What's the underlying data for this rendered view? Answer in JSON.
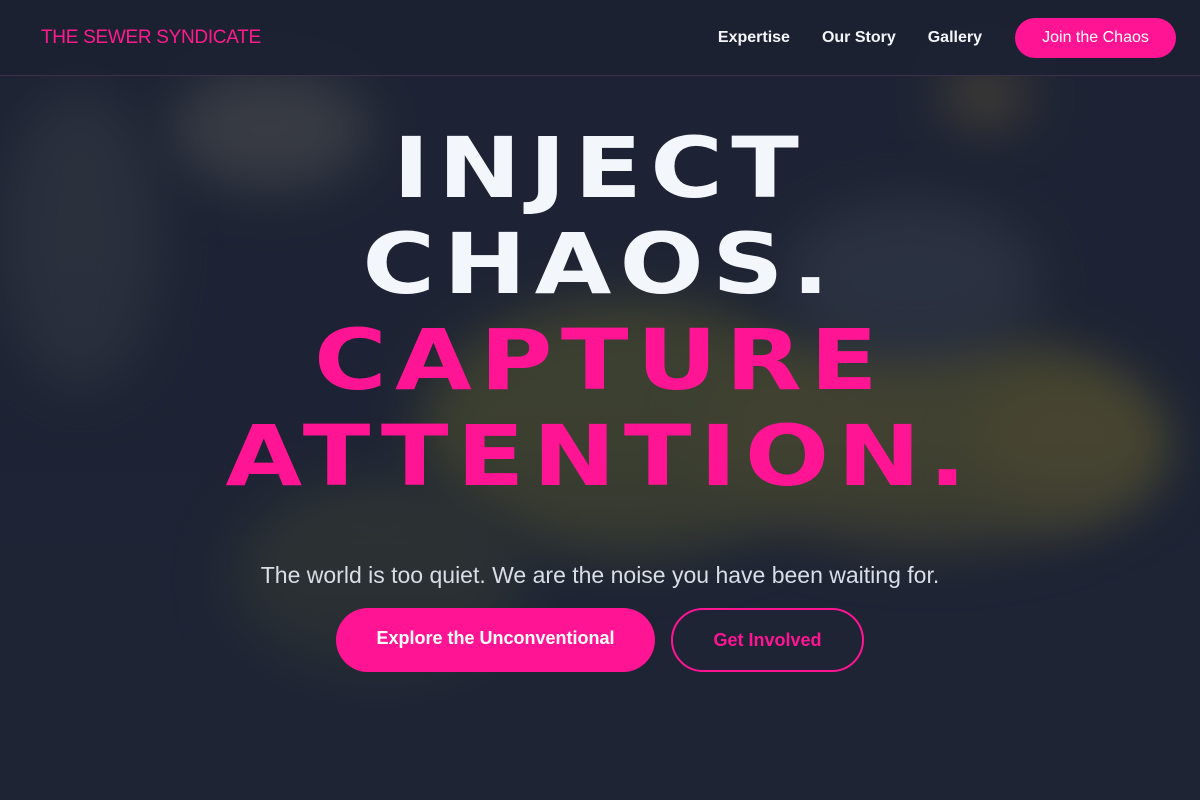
{
  "navbar": {
    "brand": "THE SEWER SYNDICATE",
    "links": [
      "Expertise",
      "Our Story",
      "Gallery"
    ],
    "cta_label": "Join the Chaos"
  },
  "hero": {
    "headline_lines": [
      "INJECT",
      "CHAOS.",
      "CAPTURE",
      "ATTENTION."
    ],
    "subtitle": "The world is too quiet. We are the noise you have been waiting for.",
    "primary_button": "Explore the Unconventional",
    "secondary_button": "Get Involved"
  },
  "colors": {
    "accent": "#ff1493",
    "background": "#1c2233",
    "headline_white": "#f3f7fc"
  }
}
